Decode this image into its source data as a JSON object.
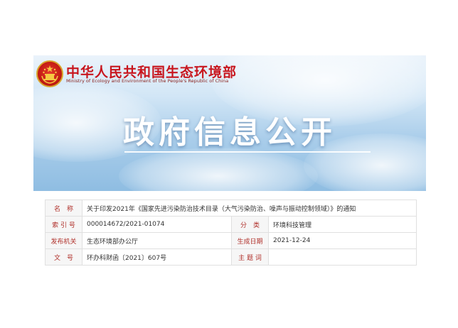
{
  "header": {
    "ministry_cn": "中华人民共和国生态环境部",
    "ministry_en": "Ministry of Ecology and Environment of the People's Republic of China",
    "banner_title": "政府信息公开"
  },
  "info": {
    "name_label": "名　称",
    "name_value": "关于印发2021年《国家先进污染防治技术目录（大气污染防治、噪声与振动控制领域）》的通知",
    "index_label": "索 引 号",
    "index_value": "000014672/2021-01074",
    "category_label": "分　类",
    "category_value": "环境科技管理",
    "issuer_label": "发布机关",
    "issuer_value": "生态环境部办公厅",
    "date_label": "生成日期",
    "date_value": "2021-12-24",
    "doc_no_label": "文　号",
    "doc_no_value": "环办科财函〔2021〕607号",
    "subject_label": "主 题 词",
    "subject_value": ""
  },
  "colors": {
    "brand_red": "#c8161e",
    "label_red": "#b0302a",
    "sky_blue": "#8fbde2"
  },
  "icons": {
    "emblem": "national-emblem-icon"
  }
}
